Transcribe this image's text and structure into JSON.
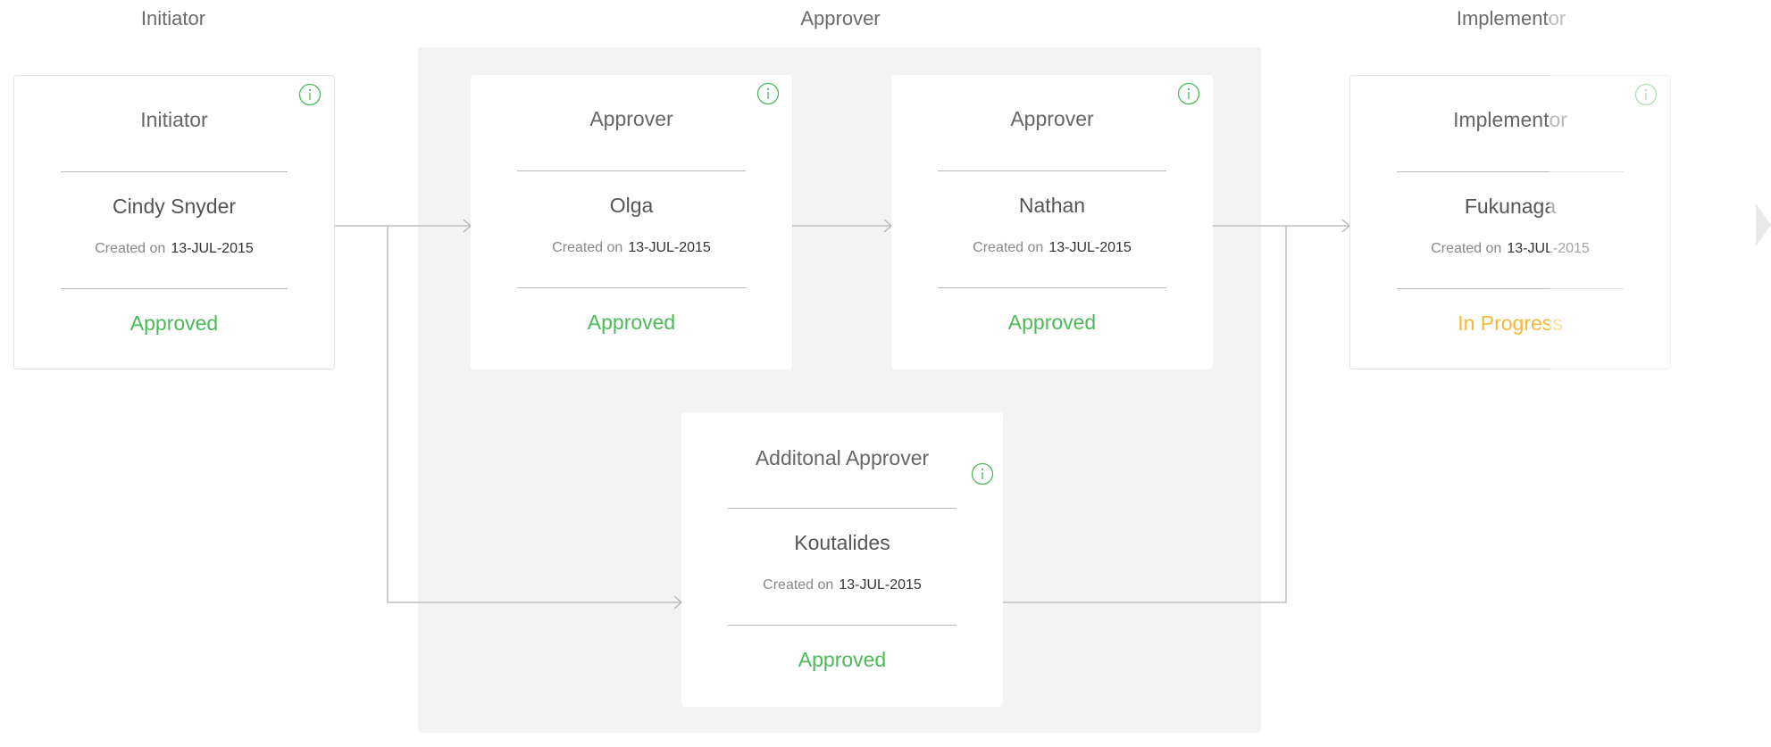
{
  "columns": {
    "initiator": "Initiator",
    "approver": "Approver",
    "implementor": "Implementor"
  },
  "created_label": "Created on",
  "cards": {
    "initiator": {
      "role": "Initiator",
      "person": "Cindy Snyder",
      "date": "13-JUL-2015",
      "status": "Approved"
    },
    "approver1": {
      "role": "Approver",
      "person": "Olga",
      "date": "13-JUL-2015",
      "status": "Approved"
    },
    "approver2": {
      "role": "Approver",
      "person": "Nathan",
      "date": "13-JUL-2015",
      "status": "Approved"
    },
    "additional": {
      "role": "Additonal Approver",
      "person": "Koutalides",
      "date": "13-JUL-2015",
      "status": "Approved"
    },
    "implementor": {
      "role": "Implementor",
      "person": "Fukunaga",
      "date": "13-JUL-2015",
      "status": "In Progress"
    }
  },
  "colors": {
    "approved": "#4cba59",
    "in_progress": "#f5b935",
    "connector": "#b4b4b4",
    "group_background": "#f3f3f3"
  },
  "icons": {
    "info": "info-circle-icon",
    "next": "chevron-right-icon"
  }
}
